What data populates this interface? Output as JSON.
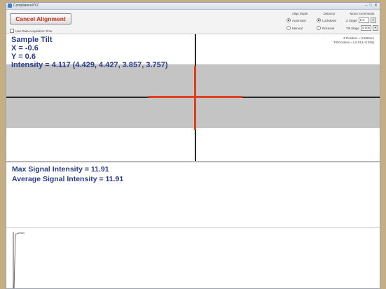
{
  "window": {
    "title": "ComplianceXYZ"
  },
  "toolbar": {
    "cancel_label": "Cancel Alignment",
    "use_time_label": "Use Data Acquisition Time",
    "align_mode": {
      "header": "Align Mode",
      "options": [
        "Automatic",
        "Manual"
      ],
      "selected": "Automatic"
    },
    "detector": {
      "header": "Detector",
      "options": [
        "Lockdown",
        "Receiver"
      ],
      "selected": "Lockdown"
    },
    "motor": {
      "header": "Motor Increments",
      "z_label": "Z Stage",
      "z_value": "5.0",
      "tilt_label": "Tilt Stage",
      "tilt_value": "0.005"
    }
  },
  "tilt": {
    "title": "Sample Tilt",
    "x_text": "X = -0.6",
    "y_text": "Y = 0.6",
    "intensity_text": "Intensity = 4.117 (4.429, 4.427, 3.857, 3.757)",
    "z_position": "Z Position = 0.506mm",
    "tilt_position": "Tilt Position = (-0.013,-0.026)",
    "x_value": -0.6,
    "y_value": 0.6,
    "crosshair_color": "#e0401f"
  },
  "signal": {
    "max_text": "Max Signal Intensity = 11.91",
    "avg_text": "Average Signal Intensity = 11.91"
  },
  "colors": {
    "accent": "#2b3d8c",
    "cancel": "#cc2a1c",
    "band": "#c4c4c4"
  }
}
